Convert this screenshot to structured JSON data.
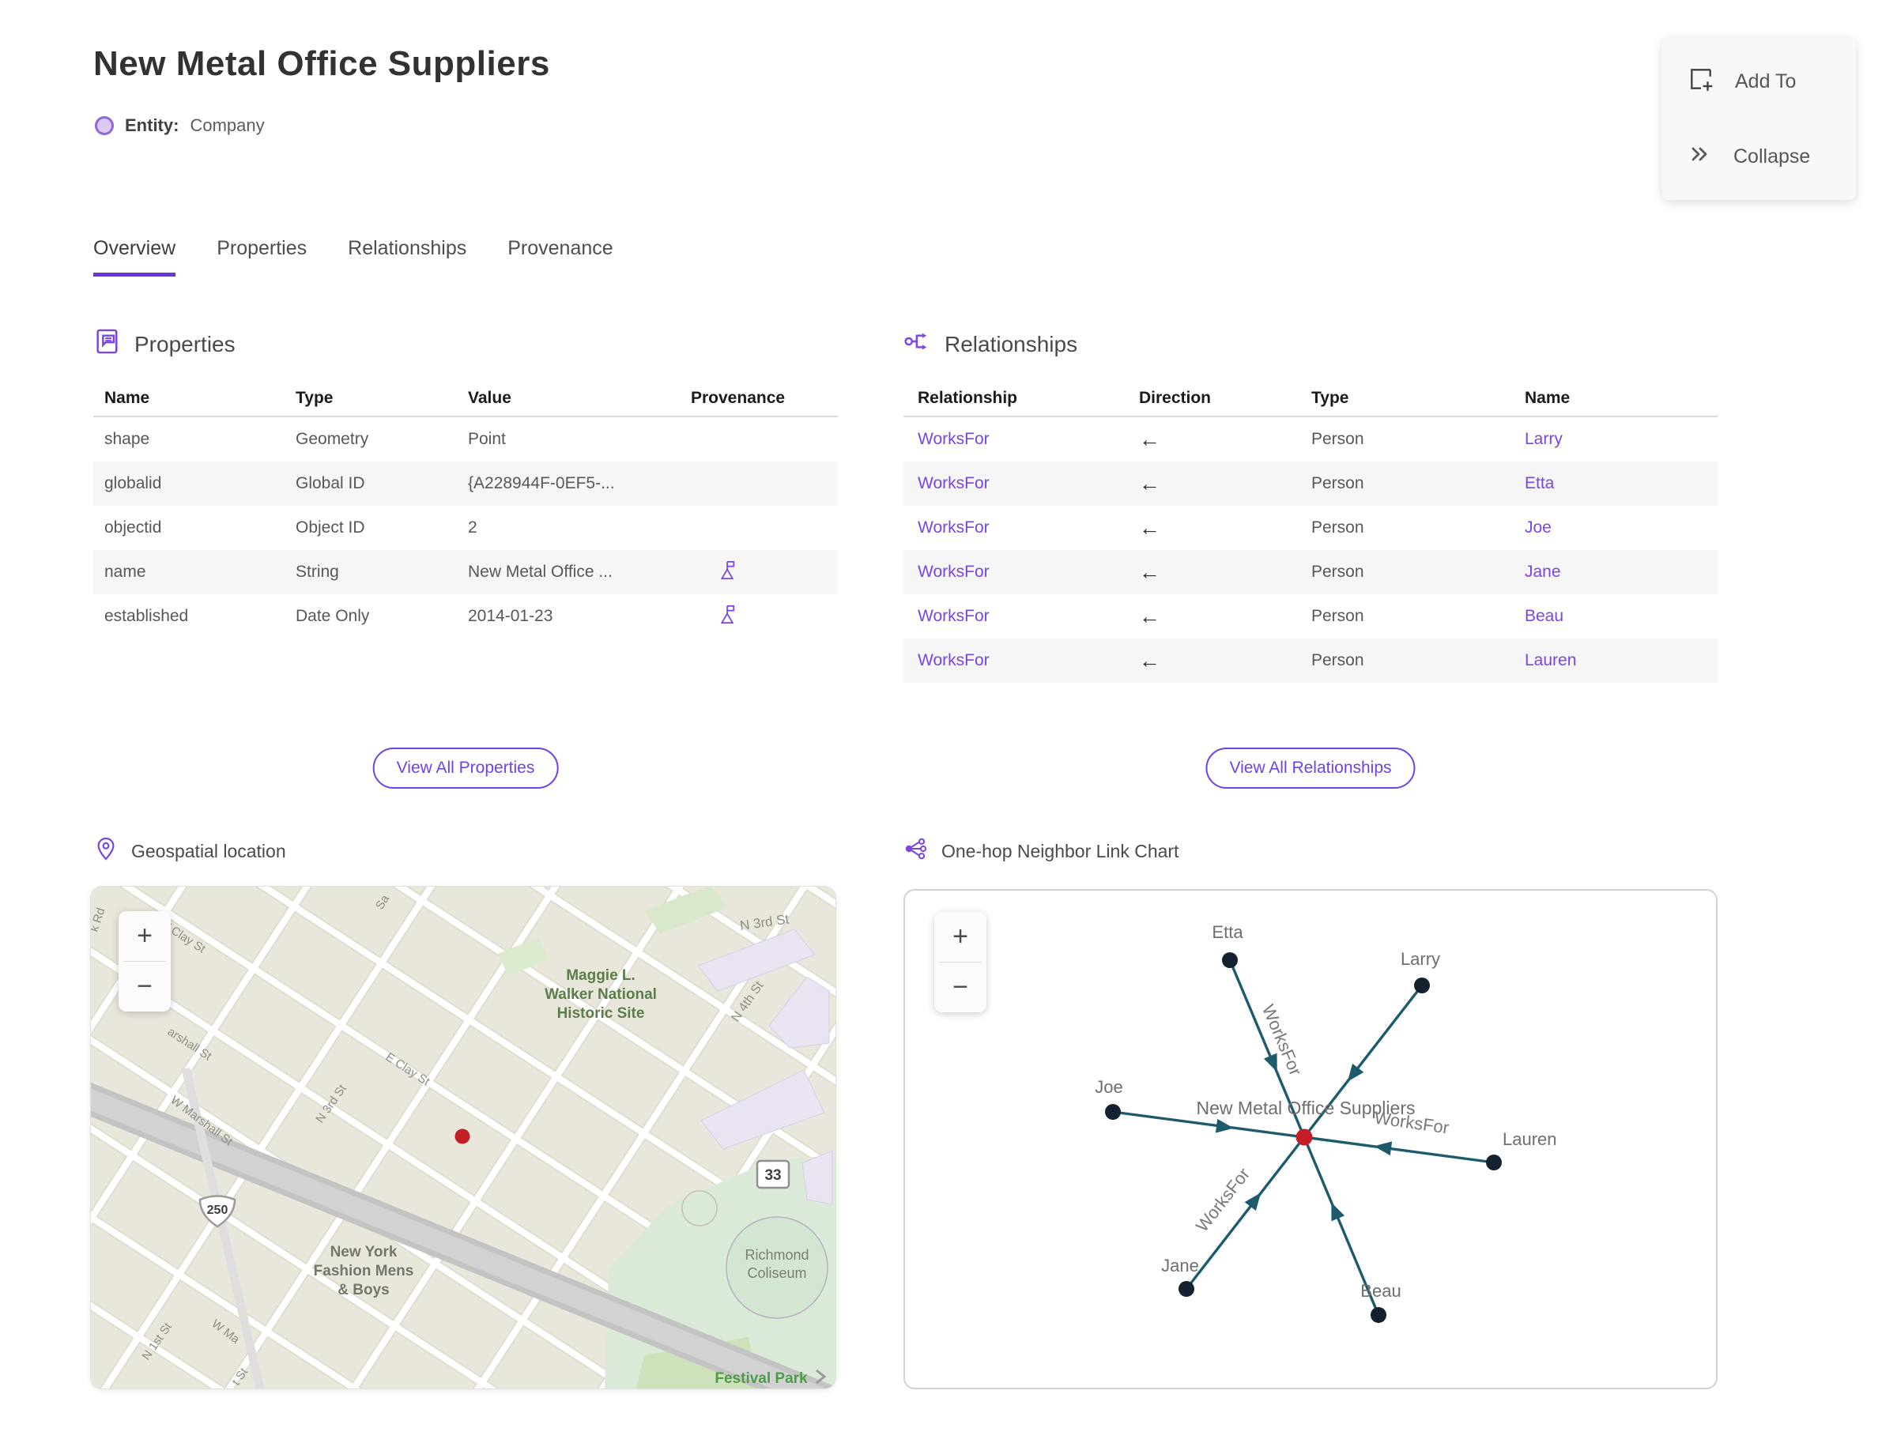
{
  "page": {
    "title": "New Metal Office Suppliers",
    "entity_label": "Entity:",
    "entity_type": "Company"
  },
  "actions": {
    "add_to": "Add To",
    "collapse": "Collapse"
  },
  "tabs": [
    {
      "label": "Overview",
      "active": true
    },
    {
      "label": "Properties",
      "active": false
    },
    {
      "label": "Relationships",
      "active": false
    },
    {
      "label": "Provenance",
      "active": false
    }
  ],
  "properties_section": {
    "heading": "Properties",
    "columns": [
      "Name",
      "Type",
      "Value",
      "Provenance"
    ],
    "rows": [
      {
        "name": "shape",
        "type": "Geometry",
        "value": "Point"
      },
      {
        "name": "globalid",
        "type": "Global ID",
        "value": "{A228944F-0EF5-..."
      },
      {
        "name": "objectid",
        "type": "Object ID",
        "value": "2"
      },
      {
        "name": "name",
        "type": "String",
        "value": "New Metal Office ..."
      },
      {
        "name": "established",
        "type": "Date Only",
        "value": "2014-01-23"
      }
    ],
    "view_all": "View All Properties"
  },
  "relationships_section": {
    "heading": "Relationships",
    "columns": [
      "Relationship",
      "Direction",
      "Type",
      "Name"
    ],
    "rows": [
      {
        "relationship": "WorksFor",
        "direction": "←",
        "type": "Person",
        "name": "Larry"
      },
      {
        "relationship": "WorksFor",
        "direction": "←",
        "type": "Person",
        "name": "Etta"
      },
      {
        "relationship": "WorksFor",
        "direction": "←",
        "type": "Person",
        "name": "Joe"
      },
      {
        "relationship": "WorksFor",
        "direction": "←",
        "type": "Person",
        "name": "Jane"
      },
      {
        "relationship": "WorksFor",
        "direction": "←",
        "type": "Person",
        "name": "Beau"
      },
      {
        "relationship": "WorksFor",
        "direction": "←",
        "type": "Person",
        "name": "Lauren"
      }
    ],
    "view_all": "View All Relationships"
  },
  "map_section": {
    "heading": "Geospatial location",
    "zoom_in": "+",
    "zoom_out": "−",
    "street_labels": [
      "W Clay St",
      "arshall St",
      "W Marshall St",
      "E Clay St",
      "N 3rd St",
      "N 4th St",
      "N 3rd St",
      "N 1st St",
      "Sa",
      "k Rd",
      "t St",
      "W Ma"
    ],
    "poi_maggie": [
      "Maggie L.",
      "Walker National",
      "Historic Site"
    ],
    "poi_ny": [
      "New York",
      "Fashion Mens",
      "& Boys"
    ],
    "poi_coliseum": [
      "Richmond",
      "Coliseum"
    ],
    "poi_festival": "Festival Park",
    "shields": [
      "250",
      "33"
    ]
  },
  "chart_section": {
    "heading": "One-hop Neighbor Link Chart",
    "zoom_in": "+",
    "zoom_out": "−",
    "center_label": "New Metal Office Suppliers",
    "edge_label_1": "WorksFor",
    "edge_label_2": "WorksFor",
    "edge_label_3": "WorksFor",
    "nodes": [
      {
        "name": "Etta"
      },
      {
        "name": "Larry"
      },
      {
        "name": "Joe"
      },
      {
        "name": "Lauren"
      },
      {
        "name": "Jane"
      },
      {
        "name": "Beau"
      }
    ]
  },
  "chart_data": {
    "type": "node-link-graph",
    "center": "New Metal Office Suppliers",
    "edges": [
      {
        "from": "Etta",
        "to": "New Metal Office Suppliers",
        "label": "WorksFor"
      },
      {
        "from": "Larry",
        "to": "New Metal Office Suppliers",
        "label": "WorksFor"
      },
      {
        "from": "Joe",
        "to": "New Metal Office Suppliers",
        "label": "WorksFor"
      },
      {
        "from": "Lauren",
        "to": "New Metal Office Suppliers",
        "label": "WorksFor"
      },
      {
        "from": "Jane",
        "to": "New Metal Office Suppliers",
        "label": "WorksFor"
      },
      {
        "from": "Beau",
        "to": "New Metal Office Suppliers",
        "label": "WorksFor"
      }
    ]
  },
  "colors": {
    "accent_purple": "#7a45e0",
    "edge_teal": "#1d5a6c",
    "node_dark": "#13222e",
    "center_red": "#c41e25"
  }
}
